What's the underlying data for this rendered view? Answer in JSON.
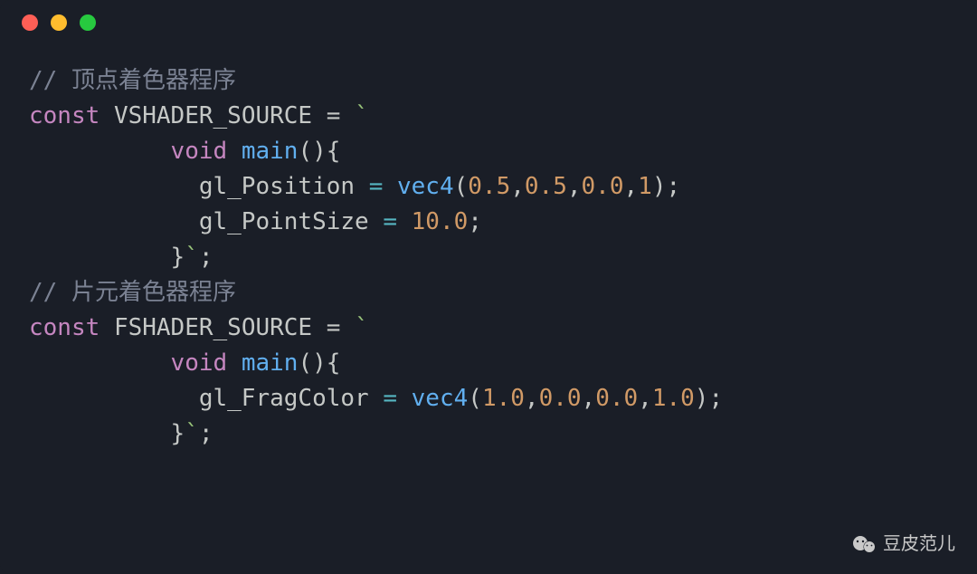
{
  "titlebar": {
    "buttons": [
      {
        "name": "close-icon",
        "color": "#ff5f56"
      },
      {
        "name": "minimize-icon",
        "color": "#ffbd2e"
      },
      {
        "name": "zoom-icon",
        "color": "#27c93f"
      }
    ]
  },
  "code": {
    "comment1_prefix": "// ",
    "comment1_text": "顶点着色器程序",
    "const_kw": "const",
    "vshader_name": "VSHADER_SOURCE",
    "eq": " = ",
    "tick": "`",
    "void_kw": "void",
    "main_fn": "main",
    "paren_open": "(",
    "paren_close": ")",
    "brace_open": "{",
    "brace_close": "}",
    "gl_position": "gl_Position",
    "vec4": "vec4",
    "v_0_5": "0.5",
    "v_0_0": "0.0",
    "v_1": "1",
    "gl_pointsize": "gl_PointSize",
    "v_10_0": "10.0",
    "semi": ";",
    "comma": ",",
    "tick_semi": "`;",
    "comment2_prefix": "// ",
    "comment2_text": "片元着色器程序",
    "fshader_name": "FSHADER_SOURCE",
    "gl_fragcolor": "gl_FragColor",
    "v_1_0": "1.0"
  },
  "watermark": {
    "text": "豆皮范儿",
    "icon": "wechat-icon"
  }
}
